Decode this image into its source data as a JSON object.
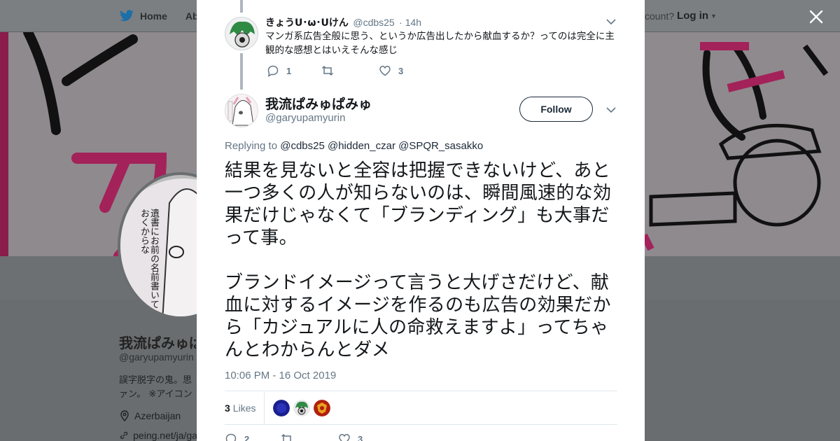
{
  "topbar": {
    "home_label": "Home",
    "about_label": "Abo",
    "have_account_text": "ccount?",
    "login_label": "Log in"
  },
  "profile": {
    "avatar_text": "遺書にお前の名前書いておくからな",
    "name": "我流ぱみゅぱみゅ",
    "handle": "@garyupamyurin",
    "bio_line1": "誤字脱字の鬼。思",
    "bio_line2": "ァン。 ※アイコン",
    "location": "Azerbaijan",
    "link": "peing.net/ja/ga"
  },
  "previous_tweet": {
    "name": "きょうU･ω･Uけん",
    "handle": "@cdbs25",
    "time": "· 14h",
    "text": "マンガ系広告全般に思う、というか広告出したから献血するか？ってのは完全に主観的な感想とはいえそんな感じ",
    "reply_count": "1",
    "retweet_count": "",
    "like_count": "3"
  },
  "tweet": {
    "name": "我流ぱみゅぱみゅ",
    "handle": "@garyupamyurin",
    "follow_label": "Follow",
    "replying_prefix": "Replying to",
    "mentions": "@cdbs25 @hidden_czar @SPQR_sasakko",
    "text": "結果を見ないと全容は把握できないけど、あと一つ多くの人が知らないのは、瞬間風速的な効果だけじゃなくて「ブランディング」も大事だって事。\n\nブランドイメージって言うと大げさだけど、献血に対するイメージを作るのも広告の効果だから「カジュアルに人の命救えますよ」ってちゃんとわからんとダメ",
    "timestamp": "10:06 PM - 16 Oct 2019",
    "likes_number": "3",
    "likes_label": "Likes",
    "reply_count": "2",
    "retweet_count": "",
    "like_count": "3"
  },
  "colors": {
    "accent": "#1c2938",
    "muted": "#657786",
    "banner_pink": "#8a1d4c"
  }
}
